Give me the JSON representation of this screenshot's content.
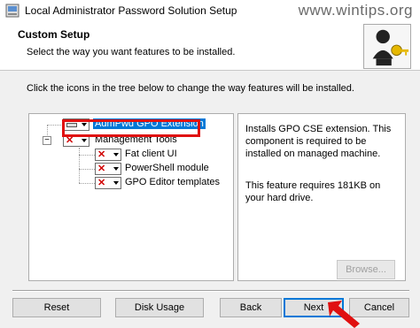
{
  "window": {
    "title": "Local Administrator Password Solution Setup",
    "watermark": "www.wintips.org"
  },
  "header": {
    "title": "Custom Setup",
    "subtitle": "Select the way you want features to be installed."
  },
  "instructions": "Click the icons in the tree below to change the way features will be installed.",
  "tree": {
    "items": [
      {
        "label": "AdmPwd GPO Extension",
        "state": "install-local",
        "icon": "hard-drive-icon",
        "selected": true
      },
      {
        "label": "Management Tools",
        "state": "not-installed",
        "icon": "x-icon",
        "selected": false
      },
      {
        "label": "Fat client UI",
        "state": "not-installed",
        "icon": "x-icon",
        "selected": false
      },
      {
        "label": "PowerShell module",
        "state": "not-installed",
        "icon": "x-icon",
        "selected": false
      },
      {
        "label": "GPO Editor templates",
        "state": "not-installed",
        "icon": "x-icon",
        "selected": false
      }
    ],
    "expander_glyph": "−"
  },
  "description": {
    "line1": "Installs GPO CSE extension. This component is required to be installed on managed machine.",
    "line2": "This feature requires 181KB on your hard drive."
  },
  "buttons": {
    "browse": "Browse...",
    "reset": "Reset",
    "disk_usage": "Disk Usage",
    "back": "Back",
    "next": "Next",
    "cancel": "Cancel"
  },
  "colors": {
    "selection": "#0078d7",
    "annotation": "#e01010",
    "not_installed": "#d00000"
  }
}
